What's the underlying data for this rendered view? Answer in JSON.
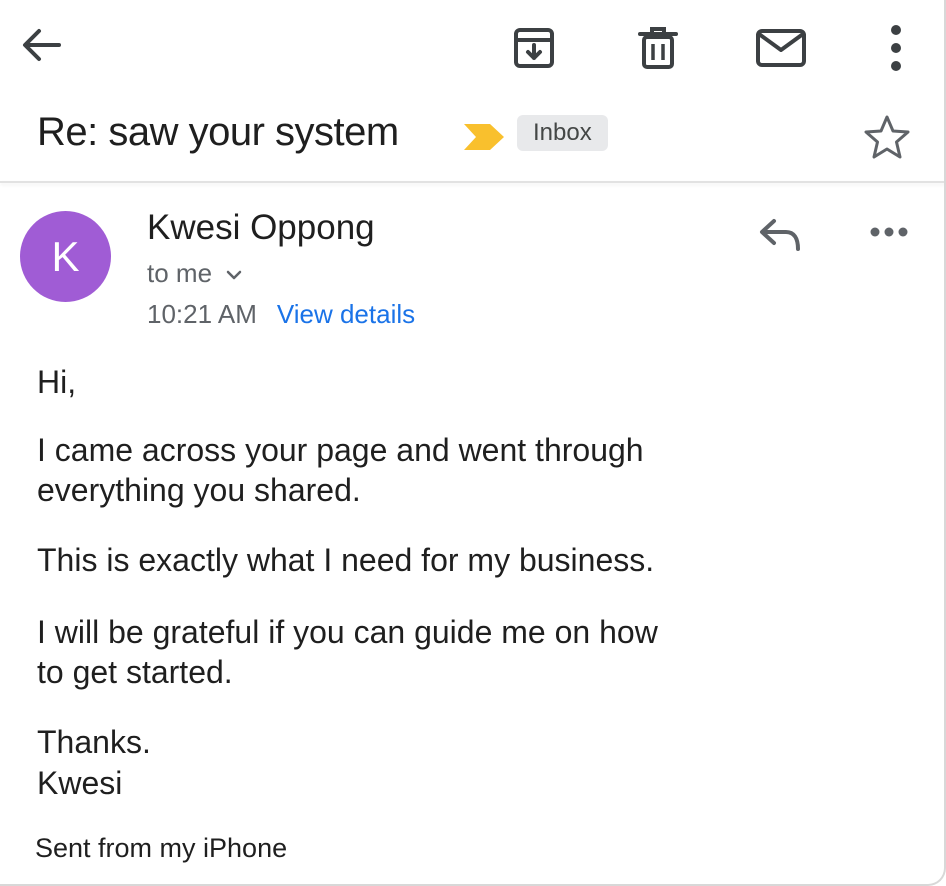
{
  "toolbar": {
    "back_icon": "arrow-left-icon",
    "archive_icon": "archive-icon",
    "delete_icon": "trash-icon",
    "mark_unread_icon": "envelope-icon",
    "more_icon": "vertical-dots-icon"
  },
  "email": {
    "subject": "Re: saw your system",
    "label": "Inbox",
    "importance_color": "#f9c02d",
    "star_icon": "star-outline-icon",
    "sender": {
      "name": "Kwesi Oppong",
      "initial": "K",
      "avatar_color": "#a05cd5"
    },
    "recipient": "to me",
    "time": "10:21 AM",
    "view_details": "View details",
    "body": {
      "greeting": "Hi,",
      "paragraph1_line1": "I came across your page and went through",
      "paragraph1_line2": "everything you shared.",
      "paragraph2": "This is exactly what I need for my business.",
      "paragraph3_line1": "I will be grateful if you can guide me on how",
      "paragraph3_line2": "to get started.",
      "closing": "Thanks.",
      "closing_name": "Kwesi"
    },
    "signature": "Sent from my iPhone"
  },
  "colors": {
    "link": "#1a73e8",
    "chip_background": "#e8e9eb",
    "secondary_text": "#5f6368"
  }
}
